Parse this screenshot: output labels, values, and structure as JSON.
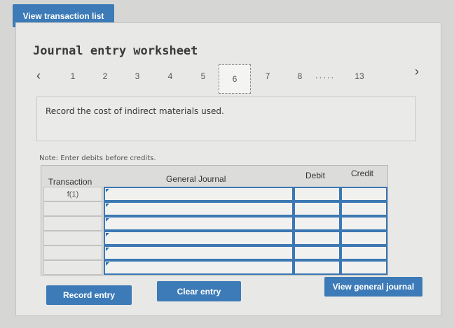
{
  "buttons": {
    "view_transaction_list": "View transaction list",
    "record_entry": "Record entry",
    "clear_entry": "Clear entry",
    "view_general_journal": "View general journal"
  },
  "worksheet": {
    "title": "Journal entry worksheet",
    "pager": {
      "prev_glyph": "‹",
      "next_glyph": "›",
      "pages": [
        "1",
        "2",
        "3",
        "4",
        "5",
        "6",
        "7",
        "8"
      ],
      "active_page": "6",
      "ellipsis": ".....",
      "last_page": "13"
    },
    "instruction": "Record the cost of indirect materials used.",
    "note": "Note: Enter debits before credits."
  },
  "journal": {
    "headers": {
      "transaction": "Transaction",
      "general_journal": "General Journal",
      "debit": "Debit",
      "credit": "Credit"
    },
    "rows": [
      {
        "transaction": "f(1)"
      },
      {
        "transaction": ""
      },
      {
        "transaction": ""
      },
      {
        "transaction": ""
      },
      {
        "transaction": ""
      },
      {
        "transaction": ""
      }
    ]
  },
  "colors": {
    "accent_button": "#3d7bb8",
    "input_border": "#3c78b4"
  }
}
